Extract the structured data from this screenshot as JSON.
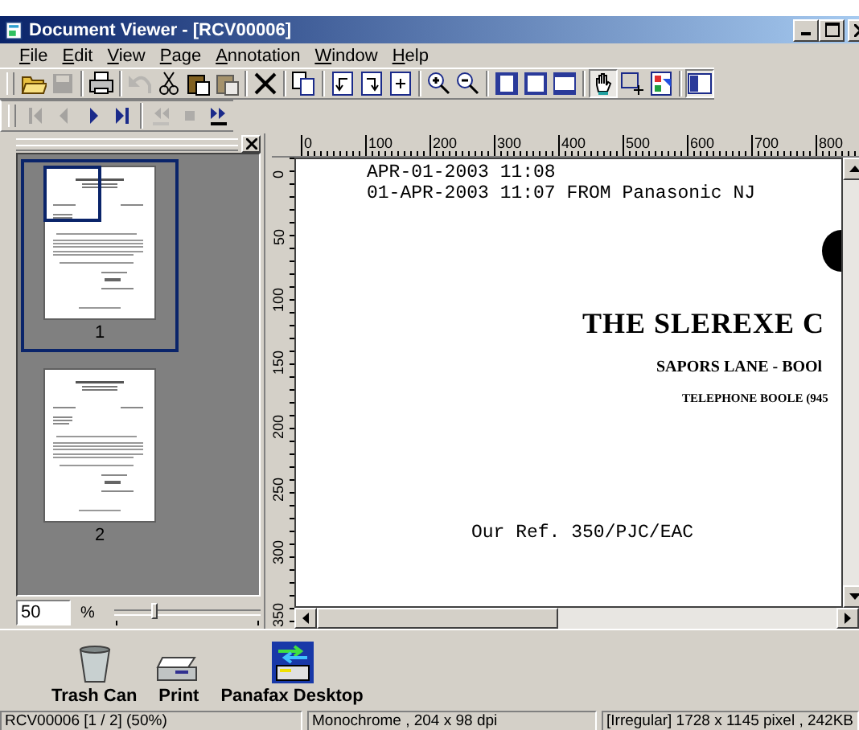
{
  "window": {
    "title": "Document Viewer - [RCV00006]"
  },
  "menu": [
    {
      "mnemonic": "F",
      "rest": "ile"
    },
    {
      "mnemonic": "E",
      "rest": "dit"
    },
    {
      "mnemonic": "V",
      "rest": "iew"
    },
    {
      "mnemonic": "P",
      "rest": "age"
    },
    {
      "mnemonic": "A",
      "rest": "nnotation"
    },
    {
      "mnemonic": "W",
      "rest": "indow"
    },
    {
      "mnemonic": "H",
      "rest": "elp"
    }
  ],
  "toolbars": [
    [
      {
        "kind": "open",
        "pressed": false,
        "disabled": false
      },
      {
        "kind": "save",
        "pressed": false,
        "disabled": true
      },
      {
        "kind": "sep"
      },
      {
        "kind": "print",
        "pressed": false,
        "disabled": false
      },
      {
        "kind": "sep"
      },
      {
        "kind": "undo",
        "pressed": false,
        "disabled": true
      },
      {
        "kind": "cut",
        "pressed": false,
        "disabled": false
      },
      {
        "kind": "paste",
        "pressed": false,
        "disabled": false
      },
      {
        "kind": "paste",
        "pressed": false,
        "disabled": true
      },
      {
        "kind": "sep"
      },
      {
        "kind": "delete",
        "pressed": false,
        "disabled": false
      },
      {
        "kind": "sep"
      },
      {
        "kind": "copy",
        "pressed": false,
        "disabled": false
      },
      {
        "kind": "sep"
      },
      {
        "kind": "rotl",
        "pressed": false,
        "disabled": false
      },
      {
        "kind": "rotr",
        "pressed": false,
        "disabled": false
      },
      {
        "kind": "pageadd",
        "pressed": false,
        "disabled": false
      },
      {
        "kind": "sep"
      },
      {
        "kind": "zoomin",
        "pressed": false,
        "disabled": false
      },
      {
        "kind": "zoomout",
        "pressed": false,
        "disabled": false
      },
      {
        "kind": "sep"
      },
      {
        "kind": "fitw",
        "pressed": false,
        "disabled": false
      },
      {
        "kind": "fitp",
        "pressed": false,
        "disabled": false
      },
      {
        "kind": "fith",
        "pressed": false,
        "disabled": false
      },
      {
        "kind": "sep"
      },
      {
        "kind": "hand",
        "pressed": true,
        "disabled": false
      },
      {
        "kind": "select",
        "pressed": false,
        "disabled": false
      },
      {
        "kind": "image",
        "pressed": false,
        "disabled": false
      },
      {
        "kind": "sep"
      },
      {
        "kind": "panel",
        "pressed": true,
        "disabled": false
      }
    ],
    [
      {
        "kind": "first",
        "pressed": false,
        "disabled": true
      },
      {
        "kind": "prev",
        "pressed": false,
        "disabled": true
      },
      {
        "kind": "next",
        "pressed": false,
        "disabled": false
      },
      {
        "kind": "last",
        "pressed": false,
        "disabled": false
      },
      {
        "kind": "sep"
      },
      {
        "kind": "autoback",
        "pressed": false,
        "disabled": true
      },
      {
        "kind": "stop",
        "pressed": false,
        "disabled": true
      },
      {
        "kind": "autofwd",
        "pressed": false,
        "disabled": false
      }
    ]
  ],
  "thumbnails": [
    {
      "label": "1",
      "selected": true
    },
    {
      "label": "2",
      "selected": false
    }
  ],
  "zoom": {
    "value": "50",
    "unit": "%",
    "level": 0.27
  },
  "ruler_h": [
    "0",
    "100",
    "200",
    "300",
    "400",
    "500",
    "600",
    "700",
    "800"
  ],
  "ruler_v": [
    "0",
    "50",
    "100",
    "150",
    "200",
    "250",
    "300",
    "350"
  ],
  "document": {
    "lines": [
      {
        "kind": "mono",
        "text": "APR-01-2003  11:08"
      },
      {
        "kind": "mono",
        "text": "01-APR-2003  11:07   FROM  Panasonic NJ"
      },
      {
        "kind": "title",
        "text": "THE SLEREXE C"
      },
      {
        "kind": "sub",
        "text": "SAPORS LANE - BOOl"
      },
      {
        "kind": "small",
        "text": "TELEPHONE BOOLE (945"
      },
      {
        "kind": "ref",
        "text": "Our Ref. 350/PJC/EAC"
      }
    ]
  },
  "desktop": [
    {
      "kind": "trash",
      "label": "Trash Can"
    },
    {
      "kind": "printer",
      "label": "Print"
    },
    {
      "kind": "fax",
      "label": "Panafax Desktop"
    }
  ],
  "status_bar": [
    "RCV00006 [1 / 2] (50%)",
    "Monochrome , 204 x 98 dpi",
    "[Irregular]  1728 x 1145 pixel , 242KB"
  ]
}
